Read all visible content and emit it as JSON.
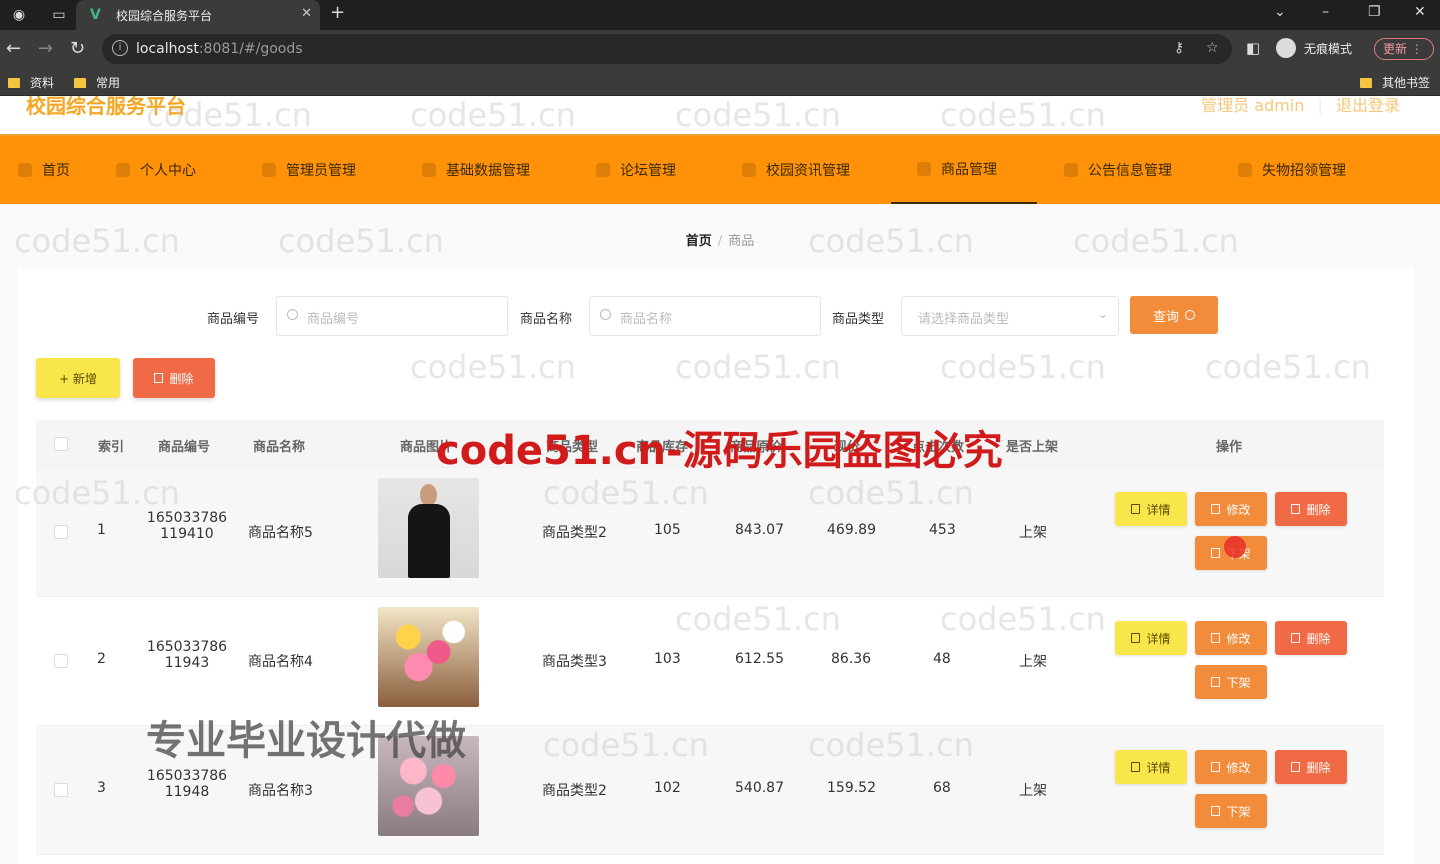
{
  "browser": {
    "tab_title": "校园综合服务平台",
    "url_host": "localhost",
    "url_rest": ":8081/#/goods",
    "incognito_label": "无痕模式",
    "update_label": "更新",
    "bookmarks": [
      "资料",
      "常用"
    ],
    "other_bookmarks": "其他书签"
  },
  "app": {
    "title": "校园综合服务平台",
    "admin_text": "管理员 admin",
    "logout_text": "退出登录"
  },
  "nav": {
    "items": [
      {
        "label": "首页"
      },
      {
        "label": "个人中心"
      },
      {
        "label": "管理员管理"
      },
      {
        "label": "基础数据管理"
      },
      {
        "label": "论坛管理"
      },
      {
        "label": "校园资讯管理"
      },
      {
        "label": "商品管理"
      },
      {
        "label": "公告信息管理"
      },
      {
        "label": "失物招领管理"
      }
    ],
    "active": "商品管理"
  },
  "breadcrumb": {
    "home": "首页",
    "sep": "/",
    "current": "商品"
  },
  "search": {
    "code_label": "商品编号",
    "code_placeholder": "商品编号",
    "name_label": "商品名称",
    "name_placeholder": "商品名称",
    "type_label": "商品类型",
    "type_placeholder": "请选择商品类型",
    "query_button": "查询"
  },
  "actions": {
    "add": "+ 新增",
    "delete": "删除"
  },
  "table": {
    "headers": [
      "索引",
      "商品编号",
      "商品名称",
      "商品图片",
      "商品类型",
      "商品库存",
      "商品原价",
      "现价",
      "点击次数",
      "是否上架",
      "操作"
    ],
    "rows": [
      {
        "index": "1",
        "code_line1": "165033786",
        "code_line2": "119410",
        "name": "商品名称5",
        "type": "商品类型2",
        "stock": "105",
        "orig": "843.07",
        "price": "469.89",
        "clicks": "453",
        "status": "上架"
      },
      {
        "index": "2",
        "code_line1": "165033786",
        "code_line2": "11943",
        "name": "商品名称4",
        "type": "商品类型3",
        "stock": "103",
        "orig": "612.55",
        "price": "86.36",
        "clicks": "48",
        "status": "上架"
      },
      {
        "index": "3",
        "code_line1": "165033786",
        "code_line2": "11948",
        "name": "商品名称3",
        "type": "商品类型2",
        "stock": "102",
        "orig": "540.87",
        "price": "159.52",
        "clicks": "68",
        "status": "上架"
      }
    ],
    "row_buttons": {
      "detail": "详情",
      "edit": "修改",
      "remove": "删除",
      "off": "下架"
    }
  },
  "watermarks": {
    "site": "code51.cn",
    "banner": "code51.cn-源码乐园盗图必究",
    "promo": "专业毕业设计代做"
  },
  "colors": {
    "nav_bg": "#ff9208",
    "accent": "#f28c3a",
    "yellow": "#f9e64a",
    "danger": "#ef6a45"
  }
}
